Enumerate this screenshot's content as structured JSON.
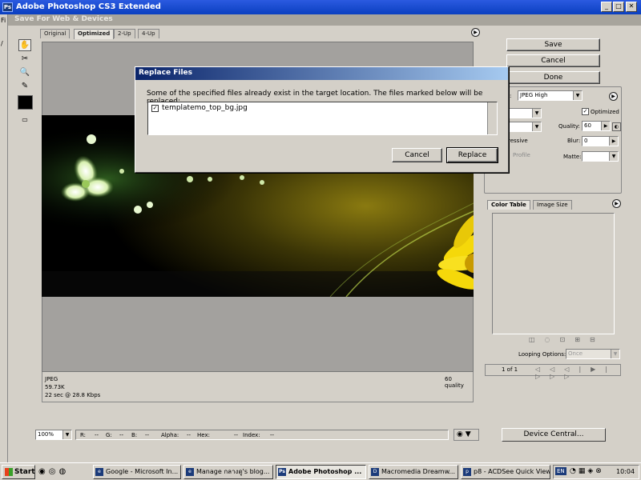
{
  "app": {
    "title": "Adobe Photoshop CS3 Extended",
    "icon_label": "Ps",
    "dialog_title": "Save For Web & Devices",
    "menu_fragments": [
      "Fi",
      "/"
    ]
  },
  "tabs": [
    {
      "label": "Original",
      "active": false
    },
    {
      "label": "Optimized",
      "active": true
    },
    {
      "label": "2-Up",
      "active": false
    },
    {
      "label": "4-Up",
      "active": false
    }
  ],
  "tools": [
    "hand-tool-icon",
    "slice-select-tool-icon",
    "zoom-tool-icon",
    "eyedropper-tool-icon",
    "eyedropper-color-icon",
    "toggle-slices-icon"
  ],
  "preview_info": {
    "format": "JPEG",
    "size": "59.73K",
    "time": "22 sec @ 28.8 Kbps",
    "quality": "60 quality"
  },
  "buttons": {
    "save": "Save",
    "cancel": "Cancel",
    "done": "Done"
  },
  "settings": {
    "preset_suffix": ":",
    "preset": "JPEG High",
    "optimized_label": "Optimized",
    "optimized_checked": true,
    "quality_label": "Quality:",
    "quality": "60",
    "progressive_fragment": "ressive",
    "blur_label": "Blur:",
    "blur": "0",
    "profile_fragment": "Profile",
    "matte_label": "Matte:"
  },
  "replace_dialog": {
    "title": "Replace Files",
    "message": "Some of the specified files already exist in the target location. The files marked below will be replaced:",
    "files": [
      {
        "name": "templatemo_top_bg.jpg",
        "checked": true
      }
    ],
    "cancel": "Cancel",
    "replace": "Replace"
  },
  "color_panel": {
    "tabs": [
      {
        "label": "Color Table",
        "active": true
      },
      {
        "label": "Image Size",
        "active": false
      }
    ],
    "looping_label": "Looping Options:",
    "looping_value": "Once",
    "frame_counter": "1 of 1"
  },
  "status": {
    "zoom": "100%",
    "r": "R:",
    "r_val": "--",
    "g": "G:",
    "g_val": "--",
    "b": "B:",
    "b_val": "--",
    "alpha": "Alpha:",
    "alpha_val": "--",
    "hex": "Hex:",
    "hex_val": "--",
    "index": "Index:",
    "index_val": "--",
    "device_central": "Device Central..."
  },
  "taskbar": {
    "start": "Start",
    "tasks": [
      {
        "label": "Google - Microsoft In...",
        "active": false
      },
      {
        "label": "Manage กลางดู's blog...",
        "active": false
      },
      {
        "label": "Adobe Photoshop ...",
        "active": true
      },
      {
        "label": "Macromedia Dreamw...",
        "active": false
      },
      {
        "label": "p8 - ACDSee Quick View",
        "active": false
      }
    ],
    "lang": "EN",
    "clock": "10:04"
  },
  "colors": {
    "title_bar": "#0a3fc0",
    "dialog_title": "#0a246a",
    "preview_bg": "#a3a19e"
  }
}
